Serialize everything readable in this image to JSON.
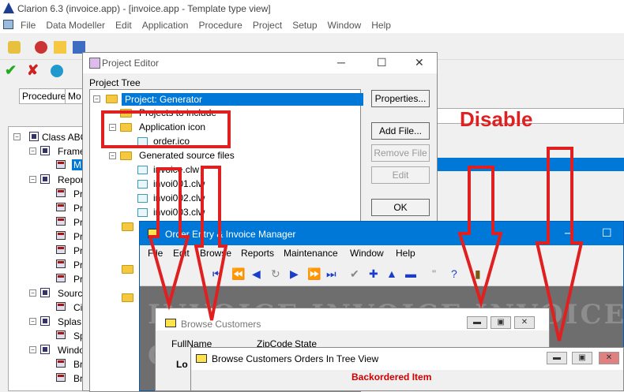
{
  "main_window": {
    "title": "Clarion 6.3 (invoice.app) - [invoice.app - Template type view]",
    "menu": [
      "File",
      "Data Modeller",
      "Edit",
      "Application",
      "Procedure",
      "Project",
      "Setup",
      "Window",
      "Help"
    ],
    "tabs": [
      "Procedure",
      "Mo"
    ],
    "tree": [
      {
        "label": "Class ABC"
      },
      {
        "label": "Frame"
      },
      {
        "label": "M"
      },
      {
        "label": "Repor"
      },
      {
        "label": "Pr"
      },
      {
        "label": "Pr"
      },
      {
        "label": "Pr"
      },
      {
        "label": "Pr"
      },
      {
        "label": "Pr"
      },
      {
        "label": "Pr"
      },
      {
        "label": "Pr"
      },
      {
        "label": "Sourc"
      },
      {
        "label": "Ci"
      },
      {
        "label": "Splas"
      },
      {
        "label": "Sp"
      },
      {
        "label": "Windo"
      },
      {
        "label": "Br"
      },
      {
        "label": "Br"
      },
      {
        "label": "Br"
      }
    ]
  },
  "project_editor": {
    "title": "Project Editor",
    "tree_label": "Project Tree",
    "tree": [
      {
        "label": "Project: Generator"
      },
      {
        "label": "Projects to include"
      },
      {
        "label": "Application icon"
      },
      {
        "label": "order.ico"
      },
      {
        "label": "Generated source files"
      },
      {
        "label": "invoice.clw"
      },
      {
        "label": "invoi001.clw"
      },
      {
        "label": "invoi002.clw"
      },
      {
        "label": "invoi003.clw"
      }
    ],
    "buttons": {
      "properties": "Properties...",
      "add_file": "Add File...",
      "remove_file": "Remove File",
      "edit": "Edit",
      "ok": "OK"
    }
  },
  "annotation": {
    "disable": "Disable",
    "color": "#e02020"
  },
  "order_entry": {
    "title": "Order Entry & Invoice Manager",
    "menu": [
      "File",
      "Edit",
      "Browse",
      "Reports",
      "Maintenance",
      "Window",
      "Help"
    ],
    "banner": "INVOICE INVOICE INVOICE",
    "banner2": "C"
  },
  "browse_customers": {
    "title": "Browse Customers",
    "tabs": [
      "FullName",
      "ZipCode",
      "State"
    ],
    "lo": "Lo"
  },
  "tree_view": {
    "title": "Browse Customers Orders In Tree View",
    "backordered": "Backordered Item"
  },
  "colors": {
    "accent": "#0078d7",
    "annotation_red": "#e02020",
    "folder": "#f5c842"
  }
}
